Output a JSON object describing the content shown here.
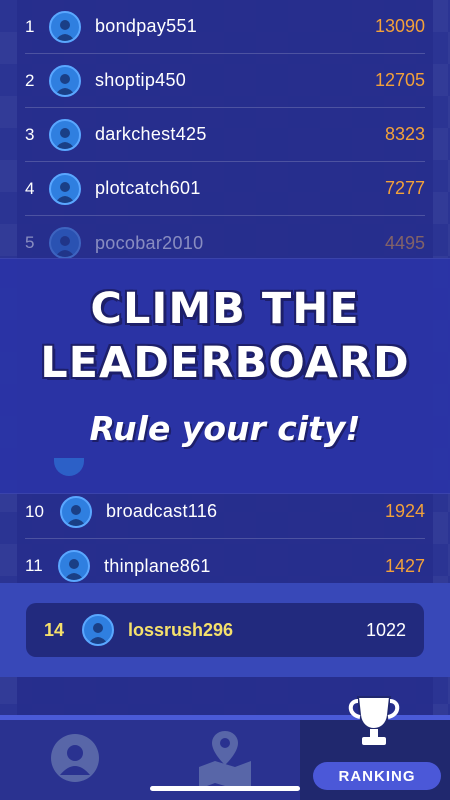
{
  "leaderboard": {
    "rows": [
      {
        "rank": "1",
        "name": "bondpay551",
        "score": "13090"
      },
      {
        "rank": "2",
        "name": "shoptip450",
        "score": "12705"
      },
      {
        "rank": "3",
        "name": "darkchest425",
        "score": "8323"
      },
      {
        "rank": "4",
        "name": "plotcatch601",
        "score": "7277"
      },
      {
        "rank": "5",
        "name": "pocobar2010",
        "score": "4495"
      },
      {
        "rank": "10",
        "name": "broadcast116",
        "score": "1924"
      },
      {
        "rank": "11",
        "name": "thinplane861",
        "score": "1427"
      }
    ]
  },
  "banner": {
    "line1": "CLIMB THE",
    "line2": "LEADERBOARD",
    "tagline": "Rule your city!"
  },
  "current_user": {
    "rank": "14",
    "name": "lossrush296",
    "score": "1022"
  },
  "tabs": {
    "profile_icon": "user-icon",
    "map_icon": "map-pin-icon",
    "ranking_icon": "trophy-icon",
    "ranking_label": "RANKING"
  },
  "colors": {
    "background": "#2b3493",
    "score": "#f2a13a",
    "highlight_text": "#f5e06c",
    "accent": "#4b58d8"
  }
}
